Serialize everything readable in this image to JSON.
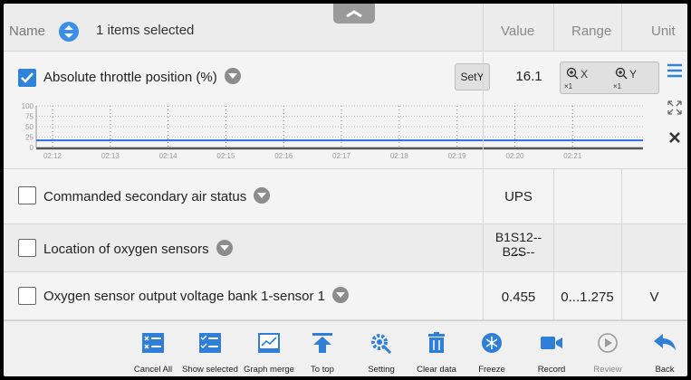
{
  "header": {
    "name_label": "Name",
    "selection_text": "1 items selected",
    "col_value": "Value",
    "col_range": "Range",
    "col_unit": "Unit"
  },
  "graph_row": {
    "label": "Absolute throttle position  (%)",
    "sety_label": "SetY",
    "value": "16.1",
    "zoom_x_label": "X",
    "zoom_y_label": "Y",
    "zoom_x_mult": "×1",
    "zoom_y_mult": "×1",
    "checked": true
  },
  "chart_data": {
    "type": "line",
    "series": [
      {
        "values": [
          17,
          17,
          17,
          17,
          17,
          17,
          17,
          17,
          17,
          17,
          17
        ]
      }
    ],
    "x": [
      "02:12",
      "02:13",
      "02:14",
      "02:15",
      "02:16",
      "02:17",
      "02:18",
      "02:19",
      "02:20",
      "02:21"
    ],
    "y_ticks": [
      "100",
      "75",
      "50",
      "25",
      "0"
    ],
    "ylim": [
      0,
      100
    ],
    "line_color": "#2f6fd6"
  },
  "rows": [
    {
      "label": "Commanded secondary air status",
      "value": "UPS",
      "range": "",
      "unit": ""
    },
    {
      "label": "Location of oxygen sensors",
      "value": "B1S12--B2S--",
      "value2": "--",
      "range": "",
      "unit": ""
    },
    {
      "label": "Oxygen sensor output voltage bank 1-sensor 1",
      "value": "0.455",
      "range": "0...1.275",
      "unit": "V"
    }
  ],
  "toolbar": [
    {
      "label": "Cancel All",
      "icon": "cancel-all-icon"
    },
    {
      "label": "Show selected",
      "icon": "show-selected-icon"
    },
    {
      "label": "Graph merge",
      "icon": "graph-merge-icon"
    },
    {
      "label": "To top",
      "icon": "to-top-icon"
    },
    {
      "label": "Setting",
      "icon": "setting-icon"
    },
    {
      "label": "Clear data",
      "icon": "clear-data-icon"
    },
    {
      "label": "Freeze",
      "icon": "freeze-icon"
    },
    {
      "label": "Record",
      "icon": "record-icon"
    },
    {
      "label": "Review",
      "icon": "review-icon"
    },
    {
      "label": "Back",
      "icon": "back-icon"
    }
  ],
  "colors": {
    "accent": "#2f83d8",
    "toolbar_icon": "#2f7fd8"
  }
}
